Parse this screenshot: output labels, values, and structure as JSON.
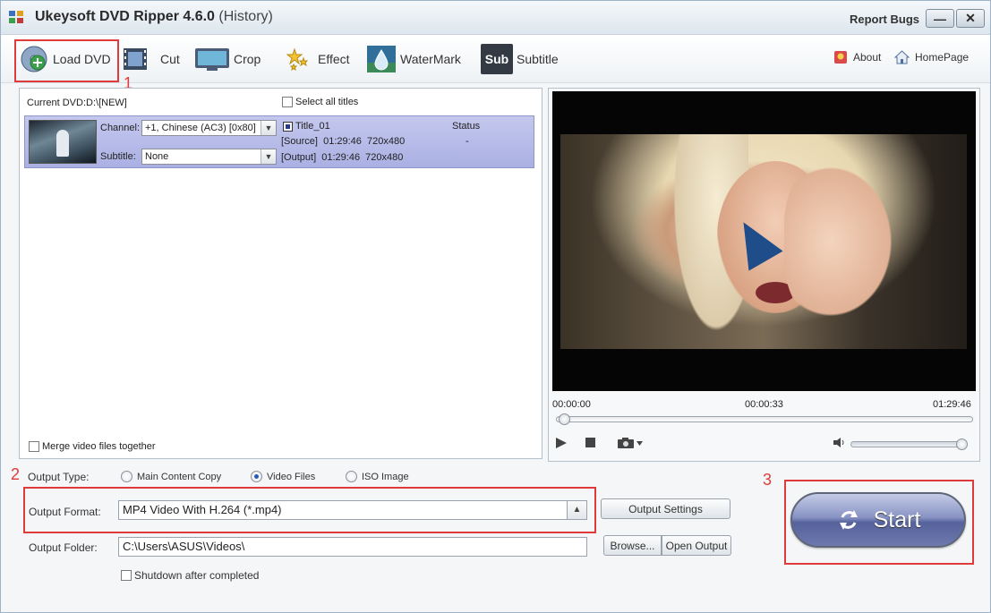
{
  "window": {
    "title": "Ukeysoft DVD Ripper 4.6.0",
    "title_suffix": "(History)",
    "report_bugs": "Report Bugs",
    "minimize_label": "—",
    "close_label": "✕"
  },
  "toolbar": {
    "load_dvd": "Load DVD",
    "cut": "Cut",
    "crop": "Crop",
    "effect": "Effect",
    "watermark": "WaterMark",
    "subtitle": "Subtitle",
    "subtitle_icon_text": "Sub",
    "about": "About",
    "homepage": "HomePage"
  },
  "annotations": {
    "n1": "1",
    "n2": "2",
    "n3": "3"
  },
  "titles_panel": {
    "current_dvd": "Current DVD:D:\\[NEW]",
    "select_all": "Select all titles",
    "channel_label": "Channel:",
    "channel_value": "+1, Chinese (AC3) [0x80]",
    "subtitle_label": "Subtitle:",
    "subtitle_value": "None",
    "title_name": "Title_01",
    "status_header": "Status",
    "status_value": "-",
    "source_line": "[Source]  01:29:46  720x480",
    "output_line": "[Output]  01:29:46  720x480",
    "merge_label": "Merge video files together"
  },
  "player": {
    "time_start": "00:00:00",
    "time_current": "00:00:33",
    "time_end": "01:29:46",
    "volume_level": 1.0
  },
  "output": {
    "type_label": "Output Type:",
    "type_options": [
      "Main Content Copy",
      "Video Files",
      "ISO Image"
    ],
    "type_selected": "Video Files",
    "format_label": "Output Format:",
    "format_value": "MP4 Video With H.264 (*.mp4)",
    "settings_button": "Output Settings",
    "folder_label": "Output Folder:",
    "folder_value": "C:\\Users\\ASUS\\Videos\\",
    "browse_button": "Browse...",
    "open_output_button": "Open Output",
    "shutdown_label": "Shutdown after completed"
  },
  "start_button": "Start",
  "colors": {
    "accent": "#e03b3b",
    "selection": "#aab0e3",
    "start": "#56629b"
  }
}
